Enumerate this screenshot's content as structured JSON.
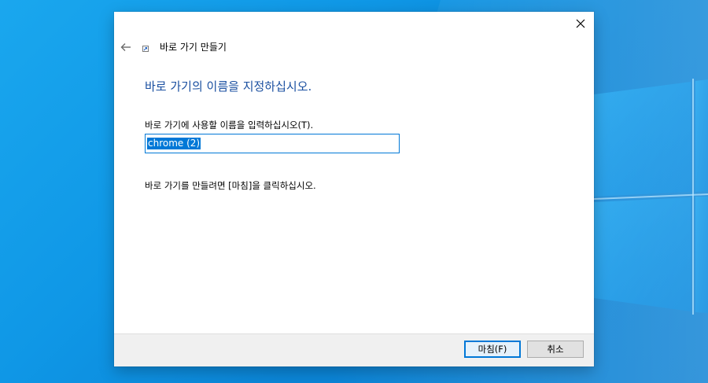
{
  "dialog": {
    "window_title": "바로 가기 만들기",
    "heading": "바로 가기의 이름을 지정하십시오.",
    "name_label": "바로 가기에 사용할 이름을 입력하십시오(T).",
    "name_value": "chrome (2)",
    "instruction": "바로 가기를 만들려면 [마침]을 클릭하십시오.",
    "buttons": {
      "finish": "마침(F)",
      "cancel": "취소"
    }
  },
  "icons": {
    "close": "close-icon",
    "back": "back-arrow-icon",
    "shortcut": "shortcut-icon"
  },
  "colors": {
    "heading": "#1a4fa0",
    "accent": "#0078d7",
    "desktop": "#0f97e6",
    "footer": "#f0f0f0"
  }
}
